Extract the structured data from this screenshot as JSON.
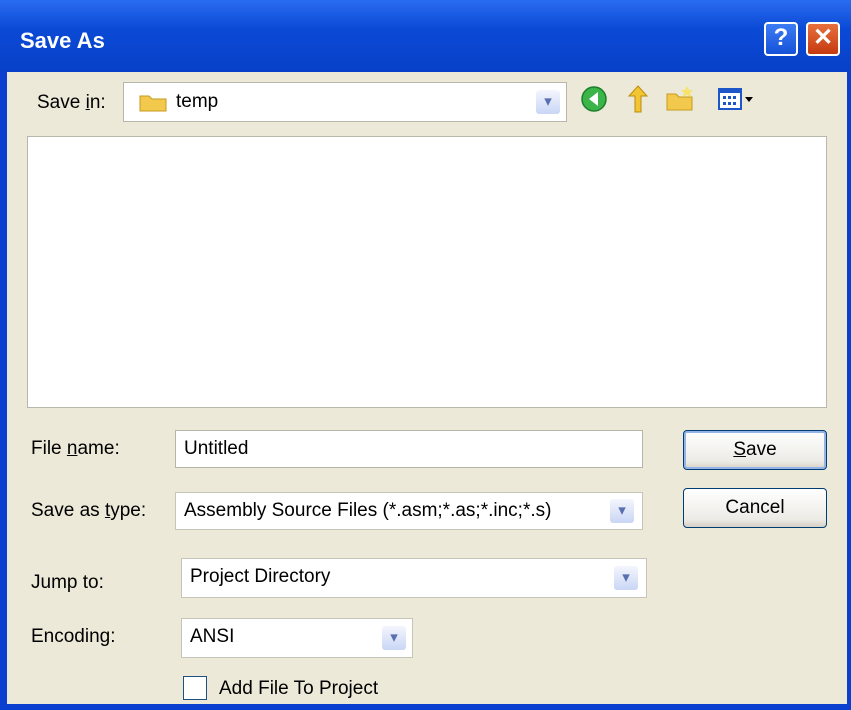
{
  "window": {
    "title": "Save As"
  },
  "titlebar": {
    "help_label": "?",
    "close_label": "✕"
  },
  "savein": {
    "label_pre": "Save ",
    "label_ul": "i",
    "label_post": "n:",
    "value": "temp"
  },
  "toolbar": {
    "back_icon": "back-icon",
    "up_icon": "up-folder-icon",
    "new_folder_icon": "new-folder-icon",
    "views_icon": "views-menu-icon"
  },
  "filename": {
    "label_pre": "File ",
    "label_ul": "n",
    "label_post": "ame:",
    "value": "Untitled"
  },
  "savetype": {
    "label_pre": "Save as ",
    "label_ul": "t",
    "label_post": "ype:",
    "value": "Assembly Source Files (*.asm;*.as;*.inc;*.s)"
  },
  "jumpto": {
    "label": "Jump to:",
    "value": "Project Directory"
  },
  "encoding": {
    "label": "Encoding:",
    "value": "ANSI"
  },
  "add_to_project": {
    "label": "Add File To Project",
    "checked": false
  },
  "buttons": {
    "save_ul": "S",
    "save_rest": "ave",
    "cancel": "Cancel"
  },
  "colors": {
    "titlebar": "#0b4ad6",
    "dialog_bg": "#ece9d8",
    "close_button": "#c53a10"
  }
}
